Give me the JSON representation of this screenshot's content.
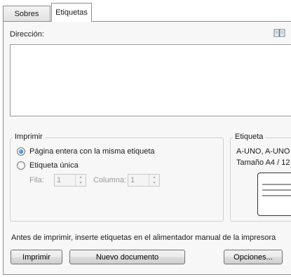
{
  "tabs": [
    {
      "label": "Sobres"
    },
    {
      "label": "Etiquetas"
    }
  ],
  "address": {
    "label": "Dirección:",
    "value": "",
    "book_icon": "address-book-icon"
  },
  "print_group": {
    "legend": "Imprimir",
    "option_full": "Página entera con la misma etiqueta",
    "option_single": "Etiqueta única",
    "row_label": "Fila:",
    "row_value": "1",
    "column_label": "Columna:",
    "column_value": "1"
  },
  "label_group": {
    "legend": "Etiqueta",
    "line1": "A-UNO, A-UNO",
    "line2": "Tamaño A4 / 12"
  },
  "note": "Antes de imprimir, inserte etiquetas en el alimentador manual de la impresora",
  "buttons": {
    "print": "Imprimir",
    "new_document": "Nuevo documento",
    "options": "Opciones..."
  },
  "colors": {
    "radio_selected": "#0d5fb0",
    "panel_bg": "#f7f7f7"
  }
}
